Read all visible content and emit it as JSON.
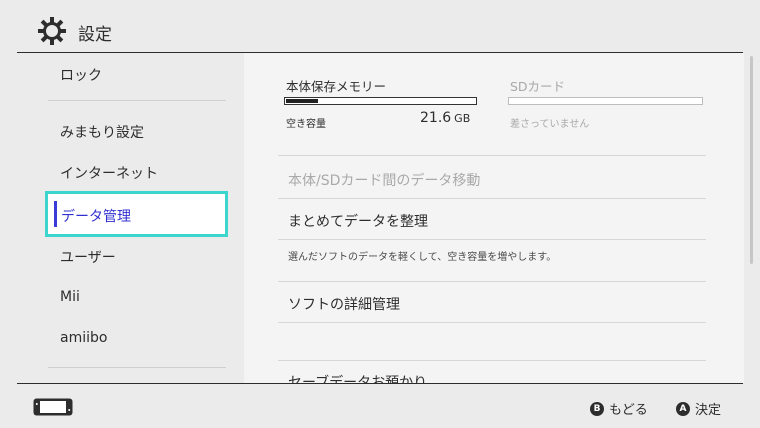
{
  "header": {
    "title": "設定",
    "icon": "gear-icon"
  },
  "sidebar": {
    "items": [
      {
        "label": "ロック"
      },
      {
        "label": "みまもり設定"
      },
      {
        "label": "インターネット"
      },
      {
        "label": "データ管理",
        "selected": true
      },
      {
        "label": "ユーザー"
      },
      {
        "label": "Mii"
      },
      {
        "label": "amiibo"
      }
    ]
  },
  "storage": {
    "internal": {
      "title": "本体保存メモリー",
      "free_label": "空き容量",
      "free_value": "21.6",
      "free_unit": "GB",
      "used_fraction": 0.17
    },
    "sd": {
      "title": "SDカード",
      "status": "差さっていません",
      "used_fraction": 0
    }
  },
  "options": [
    {
      "label": "本体/SDカード間のデータ移動",
      "disabled": true
    },
    {
      "label": "まとめてデータを整理",
      "description": "選んだソフトのデータを軽くして、空き容量を増やします。"
    },
    {
      "label": "ソフトの詳細管理"
    },
    {
      "label": "セーブデータお預かり"
    }
  ],
  "footer": {
    "back": {
      "button": "B",
      "label": "もどる"
    },
    "confirm": {
      "button": "A",
      "label": "決定"
    }
  },
  "colors": {
    "accent": "#3dd6cf",
    "selected_text": "#3030d0",
    "background": "#ebebeb",
    "content_bg": "#f4f4f4"
  }
}
